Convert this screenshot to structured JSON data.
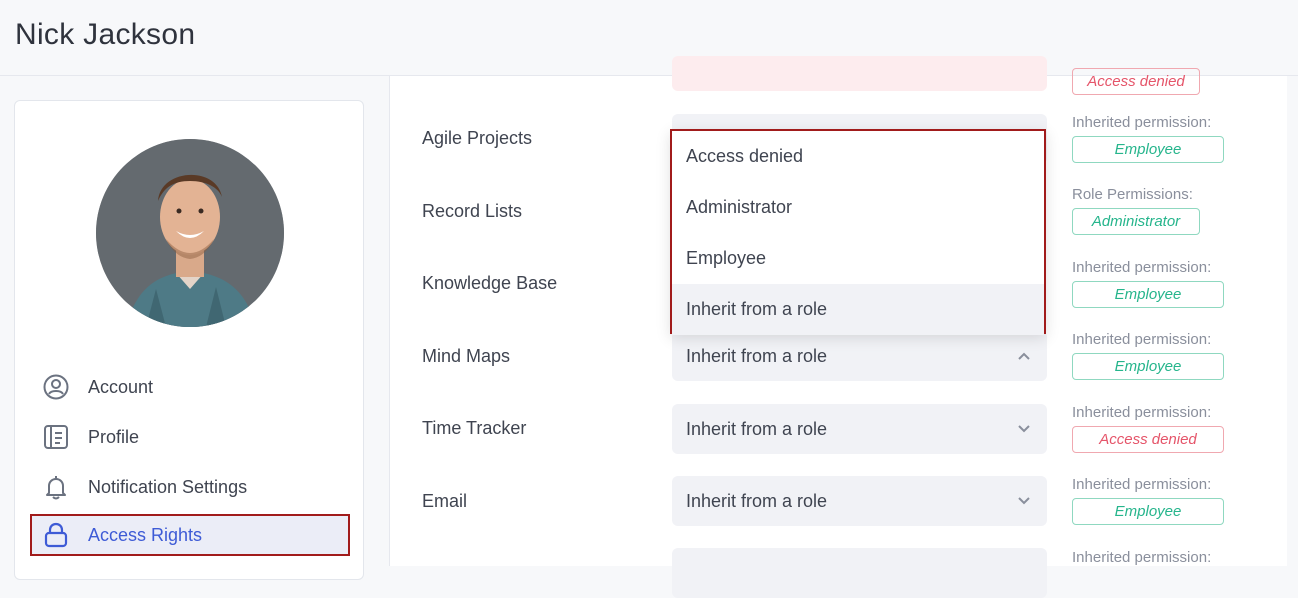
{
  "header": {
    "title": "Nick Jackson"
  },
  "sidebar": {
    "items": [
      {
        "label": "Account",
        "icon": "account-circle-icon"
      },
      {
        "label": "Profile",
        "icon": "profile-card-icon"
      },
      {
        "label": "Notification Settings",
        "icon": "bell-icon"
      },
      {
        "label": "Access Rights",
        "icon": "lock-icon",
        "active": true
      }
    ]
  },
  "modules": {
    "top_badge": "Access denied",
    "rows": [
      {
        "label": "Agile Projects",
        "perm_title": "Inherited permission:",
        "perm_value": "Employee"
      },
      {
        "label": "Record Lists",
        "perm_title": "Role Permissions:",
        "perm_value": "Administrator"
      },
      {
        "label": "Knowledge Base",
        "perm_title": "Inherited permission:",
        "perm_value": "Employee"
      },
      {
        "label": "Mind Maps",
        "select": "Inherit from a role",
        "perm_title": "Inherited permission:",
        "perm_value": "Employee"
      },
      {
        "label": "Time Tracker",
        "select": "Inherit from a role",
        "perm_title": "Inherited permission:",
        "perm_value": "Access denied"
      },
      {
        "label": "Email",
        "select": "Inherit from a role",
        "perm_title": "Inherited permission:",
        "perm_value": "Employee"
      },
      {
        "label": "",
        "perm_title": "Inherited permission:"
      }
    ]
  },
  "dropdown": {
    "options": [
      "Access denied",
      "Administrator",
      "Employee",
      "Inherit from a role"
    ],
    "highlighted": "Inherit from a role"
  },
  "colors": {
    "accent": "#3e5bd6",
    "highlight_border": "#a11b1b",
    "employee_green": "#26b58c",
    "denied_red": "#e5556a"
  }
}
